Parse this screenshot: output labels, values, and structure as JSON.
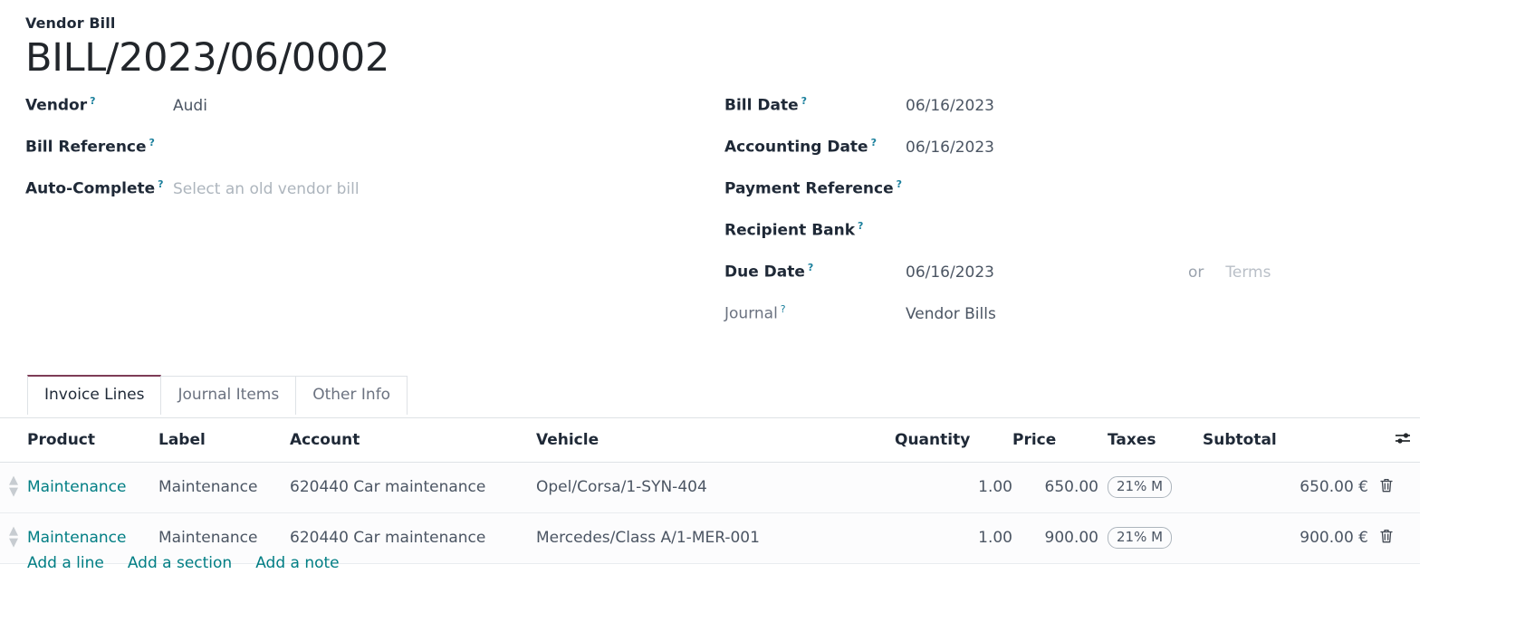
{
  "document": {
    "kind": "Vendor Bill",
    "number": "BILL/2023/06/0002"
  },
  "left_fields": [
    {
      "label": "Vendor",
      "help": "?",
      "value": "Audi",
      "placeholder": false
    },
    {
      "label": "Bill Reference",
      "help": "?",
      "value": "",
      "placeholder": false
    },
    {
      "label": "Auto-Complete",
      "help": "?",
      "value": "Select an old vendor bill",
      "placeholder": true
    }
  ],
  "right_fields": [
    {
      "label": "Bill Date",
      "help": "?",
      "value": "06/16/2023",
      "muted": false
    },
    {
      "label": "Accounting Date",
      "help": "?",
      "value": "06/16/2023",
      "muted": false
    },
    {
      "label": "Payment Reference",
      "help": "?",
      "value": "",
      "muted": false
    },
    {
      "label": "Recipient Bank",
      "help": "?",
      "value": "",
      "muted": false
    },
    {
      "label": "Due Date",
      "help": "?",
      "value": "06/16/2023",
      "muted": false
    },
    {
      "label": "Journal",
      "help": "?",
      "value": "Vendor Bills",
      "muted": true
    }
  ],
  "due_date_extra": {
    "or_label": "or",
    "terms_placeholder": "Terms"
  },
  "tabs": [
    {
      "label": "Invoice Lines",
      "active": true
    },
    {
      "label": "Journal Items",
      "active": false
    },
    {
      "label": "Other Info",
      "active": false
    }
  ],
  "table": {
    "columns": [
      "Product",
      "Label",
      "Account",
      "Vehicle",
      "Quantity",
      "Price",
      "Taxes",
      "Subtotal"
    ],
    "optional_columns_icon": "sliders-icon",
    "rows": [
      {
        "handle": "drag-handle-icon",
        "product": "Maintenance",
        "label": "Maintenance",
        "account": "620440 Car maintenance",
        "vehicle": "Opel/Corsa/1-SYN-404",
        "quantity": "1.00",
        "price": "650.00",
        "taxes": "21% M",
        "subtotal": "650.00 €",
        "delete_icon": "trash-icon"
      },
      {
        "handle": "drag-handle-icon",
        "product": "Maintenance",
        "label": "Maintenance",
        "account": "620440 Car maintenance",
        "vehicle": "Mercedes/Class A/1-MER-001",
        "quantity": "1.00",
        "price": "900.00",
        "taxes": "21% M",
        "subtotal": "900.00 €",
        "delete_icon": "trash-icon"
      }
    ]
  },
  "add_actions": [
    {
      "label": "Add a line"
    },
    {
      "label": "Add a section"
    },
    {
      "label": "Add a note"
    }
  ],
  "colors": {
    "link": "#017e84",
    "active_tab_border": "#7d3c57",
    "help_marker": "#1a7f9c",
    "title": "#22262b"
  }
}
